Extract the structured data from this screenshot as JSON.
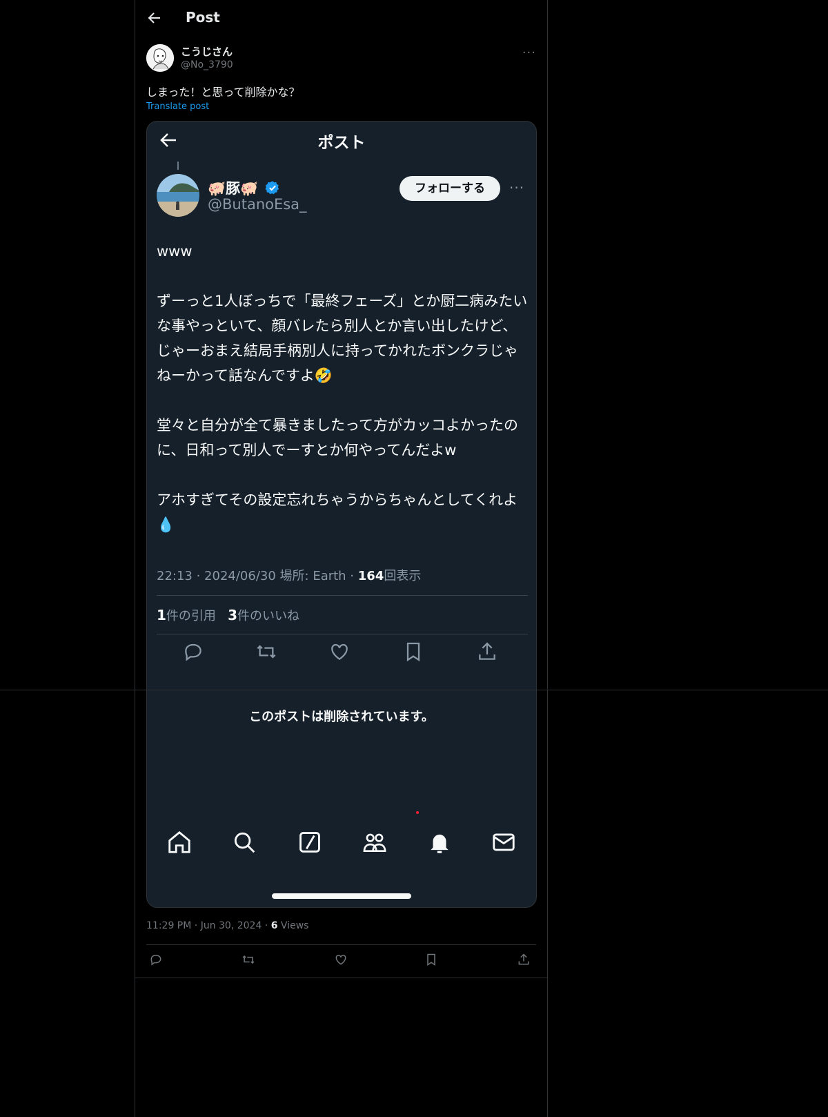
{
  "header": {
    "title": "Post"
  },
  "post": {
    "author_name": "こうじさん",
    "author_handle": "@No_3790",
    "text": "しまった！と思って削除かな？",
    "translate_label": "Translate post",
    "time": "11:29 PM",
    "date": "Jun 30, 2024",
    "views_count": "6",
    "views_label": "Views",
    "more_label": "···"
  },
  "screenshot": {
    "title": "ポスト",
    "name": "🐖豚🐖",
    "handle": "@ButanoEsa_",
    "follow_label": "フォローする",
    "more_label": "···",
    "body": "www\n\nずーっと1人ぼっちで「最終フェーズ」とか厨二病みたいな事やっといて、顔バレたら別人とか言い出したけど、じゃーおまえ結局手柄別人に持ってかれたボンクラじゃねーかって話なんですよ🤣\n\n堂々と自分が全て暴きましたって方がカッコよかったのに、日和って別人でーすとか何やってんだよw\n\nアホすぎてその設定忘れちゃうからちゃんとしてくれよ💧",
    "meta_time": "22:13 · 2024/06/30",
    "meta_location": "場所: Earth ·",
    "meta_views_count": "164",
    "meta_views_label": "回表示",
    "quotes_count": "1",
    "quotes_label": "件の引用",
    "likes_count": "3",
    "likes_label": "件のいいね",
    "deleted_notice": "このポストは削除されています。"
  },
  "colors": {
    "background": "#000000",
    "card": "#16202a",
    "link": "#1d9bf0",
    "muted": "#71767b",
    "verified": "#1d9bf0"
  },
  "icons": [
    "back-arrow-icon",
    "more-icon",
    "reply-icon",
    "retweet-icon",
    "like-icon",
    "bookmark-icon",
    "share-icon",
    "home-icon",
    "search-icon",
    "grok-icon",
    "communities-icon",
    "bell-icon",
    "mail-icon",
    "verified-badge-icon"
  ]
}
